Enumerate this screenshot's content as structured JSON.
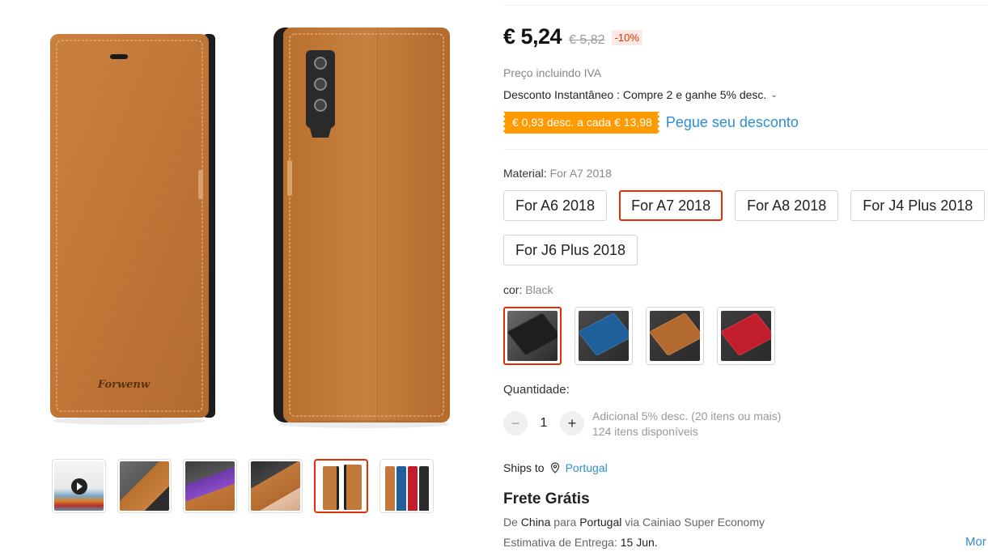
{
  "gallery": {
    "main_image": {
      "brand_text": "Forwenw",
      "case_color": "#c47a3a"
    },
    "thumbnails": [
      {
        "name": "video-thumb",
        "has_play": true,
        "active": false
      },
      {
        "name": "thumb-open-case",
        "has_play": false,
        "active": false
      },
      {
        "name": "thumb-stand-case",
        "has_play": false,
        "active": false
      },
      {
        "name": "thumb-hand-case",
        "has_play": false,
        "active": false
      },
      {
        "name": "thumb-front-back",
        "has_play": false,
        "active": true
      },
      {
        "name": "thumb-colors",
        "has_play": false,
        "active": false
      }
    ]
  },
  "price": {
    "current": "€ 5,24",
    "original": "€ 5,82",
    "discount_badge": "-10%"
  },
  "vat_note": "Preço incluindo IVA",
  "instant_discount": "Desconto Instantâneo : Compre 2 e ganhe 5% desc.",
  "coupon": {
    "tag": "€ 0,93 desc. a cada € 13,98",
    "link": "Pegue seu desconto"
  },
  "material": {
    "label": "Material: ",
    "selected": "For A7 2018",
    "options": [
      "For A6 2018",
      "For A7 2018",
      "For A8 2018",
      "For J4 Plus 2018",
      "For J6 Plus 2018"
    ],
    "active_index": 1
  },
  "color": {
    "label": "cor: ",
    "selected": "Black",
    "swatches": [
      {
        "name": "black",
        "hex": "#1e1e1e",
        "bg": "#6b6b6b"
      },
      {
        "name": "blue",
        "hex": "#1f5f9a",
        "bg": "#4a4a4a"
      },
      {
        "name": "brown",
        "hex": "#b36a2e",
        "bg": "#3f3f3f"
      },
      {
        "name": "red",
        "hex": "#c21d2b",
        "bg": "#3d3d3d"
      }
    ],
    "active_index": 0
  },
  "quantity": {
    "label": "Quantidade:",
    "value": "1",
    "minus": "−",
    "plus": "+",
    "bulk_note": "Adicional 5% desc. (20 itens ou mais)",
    "available": "124 itens disponíveis"
  },
  "ships": {
    "label": "Ships to",
    "country": "Portugal"
  },
  "shipping": {
    "title": "Frete Grátis",
    "route_prefix": "De ",
    "route_from": "China",
    "route_mid": " para ",
    "route_to": "Portugal",
    "route_via": " via Cainiao Super Economy",
    "delivery_prefix": "Estimativa de Entrega: ",
    "delivery_date": "15 Jun.",
    "more_link": "Mor"
  },
  "colors": {
    "accent_red": "#e62e04",
    "link_blue": "#2e8ed1",
    "coupon_orange": "#ff9a00"
  }
}
